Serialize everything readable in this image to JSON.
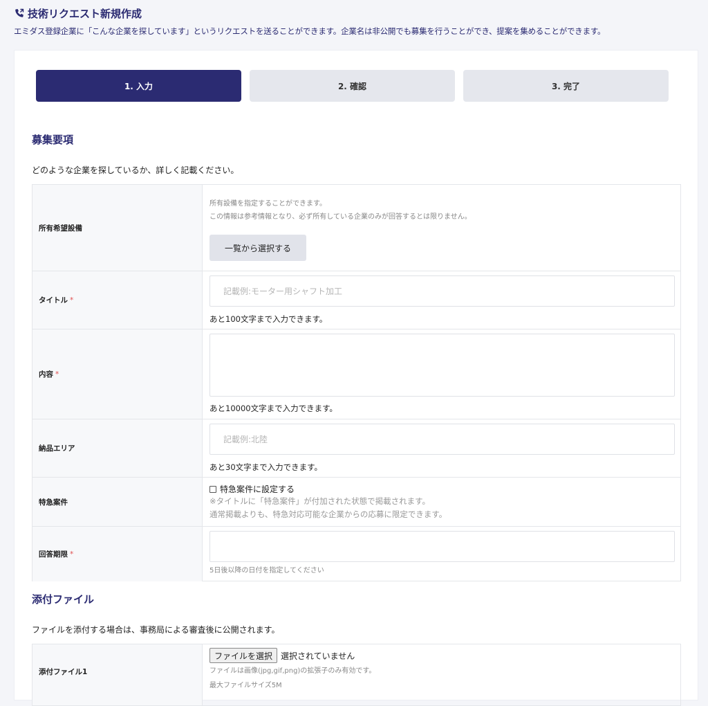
{
  "header": {
    "title": "技術リクエスト新規作成",
    "description": "エミダス登録企業に「こんな企業を探しています」というリクエストを送ることができます。企業名は非公開でも募集を行うことができ、提案を集めることができます。"
  },
  "steps": [
    {
      "label": "1. 入力",
      "active": true
    },
    {
      "label": "2. 確認",
      "active": false
    },
    {
      "label": "3. 完了",
      "active": false
    }
  ],
  "recruit": {
    "title": "募集要項",
    "description": "どのような企業を探しているか、詳しく記載ください。",
    "required_mark": "*",
    "equipment": {
      "label": "所有希望設備",
      "hint1": "所有設備を指定することができます。",
      "hint2": "この情報は参考情報となり、必ず所有している企業のみが回答するとは限りません。",
      "button": "一覧から選択する"
    },
    "title_field": {
      "label": "タイトル",
      "placeholder": "記載例:モーター用シャフト加工",
      "value": "",
      "counter": "あと100文字まで入力できます。"
    },
    "content": {
      "label": "内容",
      "value": "",
      "counter": "あと10000文字まで入力できます。"
    },
    "area": {
      "label": "納品エリア",
      "placeholder": "記載例:北陸",
      "value": "",
      "counter": "あと30文字まで入力できます。"
    },
    "urgent": {
      "label": "特急案件",
      "checkbox_label": "特急案件に設定する",
      "checked": false,
      "note1": "※タイトルに「特急案件」が付加された状態で掲載されます。",
      "note2": "通常掲載よりも、特急対応可能な企業からの応募に限定できます。"
    },
    "deadline": {
      "label": "回答期限",
      "value": "",
      "hint": "5日後以降の日付を指定してください"
    }
  },
  "attachments": {
    "title": "添付ファイル",
    "description": "ファイルを添付する場合は、事務局による審査後に公開されます。",
    "file1": {
      "label": "添付ファイル1",
      "button": "ファイルを選択",
      "status": "選択されていません",
      "hint1": "ファイルは画像(jpg,gif,png)の拡張子のみ有効です。",
      "hint2": "最大ファイルサイズ5M"
    }
  },
  "colors": {
    "accent": "#2b2b72",
    "required": "#e05050"
  }
}
